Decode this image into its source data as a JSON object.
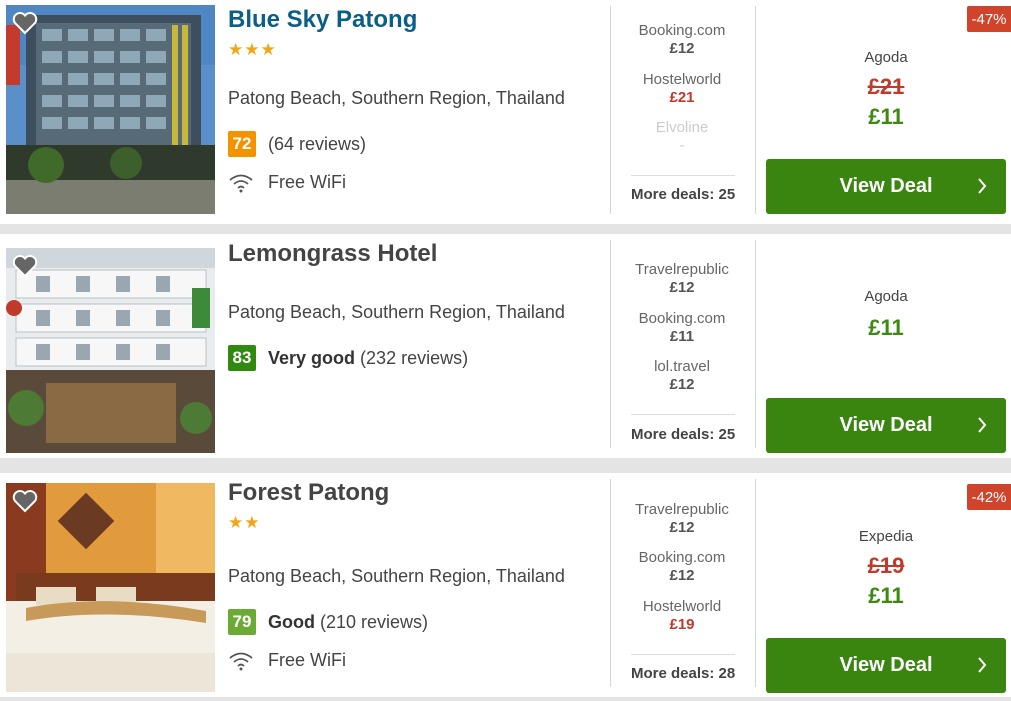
{
  "hotels": [
    {
      "name": "Blue Sky Patong",
      "stars": "★★★",
      "location": "Patong Beach, Southern Region, Thailand",
      "score": "72",
      "rating_label": "",
      "reviews": "(64 reviews)",
      "amenity": "Free WiFi",
      "deals": [
        {
          "provider": "Booking.com",
          "price": "£12"
        },
        {
          "provider": "Hostelworld",
          "price": "£21"
        },
        {
          "provider": "Elvoline",
          "price": "-"
        }
      ],
      "more_deals": "More deals: 25",
      "best_provider": "Agoda",
      "old_price": "£21",
      "new_price": "£11",
      "discount": "-47%",
      "cta": "View Deal"
    },
    {
      "name": "Lemongrass Hotel",
      "stars": "",
      "location": "Patong Beach, Southern Region, Thailand",
      "score": "83",
      "rating_label": "Very good",
      "reviews": "(232 reviews)",
      "amenity": "",
      "deals": [
        {
          "provider": "Travelrepublic",
          "price": "£12"
        },
        {
          "provider": "Booking.com",
          "price": "£11"
        },
        {
          "provider": "lol.travel",
          "price": "£12"
        }
      ],
      "more_deals": "More deals: 25",
      "best_provider": "Agoda",
      "old_price": "",
      "new_price": "£11",
      "discount": "",
      "cta": "View Deal"
    },
    {
      "name": "Forest Patong",
      "stars": "★★",
      "location": "Patong Beach, Southern Region, Thailand",
      "score": "79",
      "rating_label": "Good",
      "reviews": "(210 reviews)",
      "amenity": "Free WiFi",
      "deals": [
        {
          "provider": "Travelrepublic",
          "price": "£12"
        },
        {
          "provider": "Booking.com",
          "price": "£12"
        },
        {
          "provider": "Hostelworld",
          "price": "£19"
        }
      ],
      "more_deals": "More deals: 28",
      "best_provider": "Expedia",
      "old_price": "£19",
      "new_price": "£11",
      "discount": "-42%",
      "cta": "View Deal"
    }
  ],
  "colors": {
    "title_link": "#0b5e85",
    "star": "#f4a516",
    "cta_green": "#3a8410",
    "price_green": "#3c8a12",
    "discount_red": "#d0442c"
  },
  "icons": [
    "heart-icon",
    "wifi-icon",
    "chevron-right-icon"
  ]
}
